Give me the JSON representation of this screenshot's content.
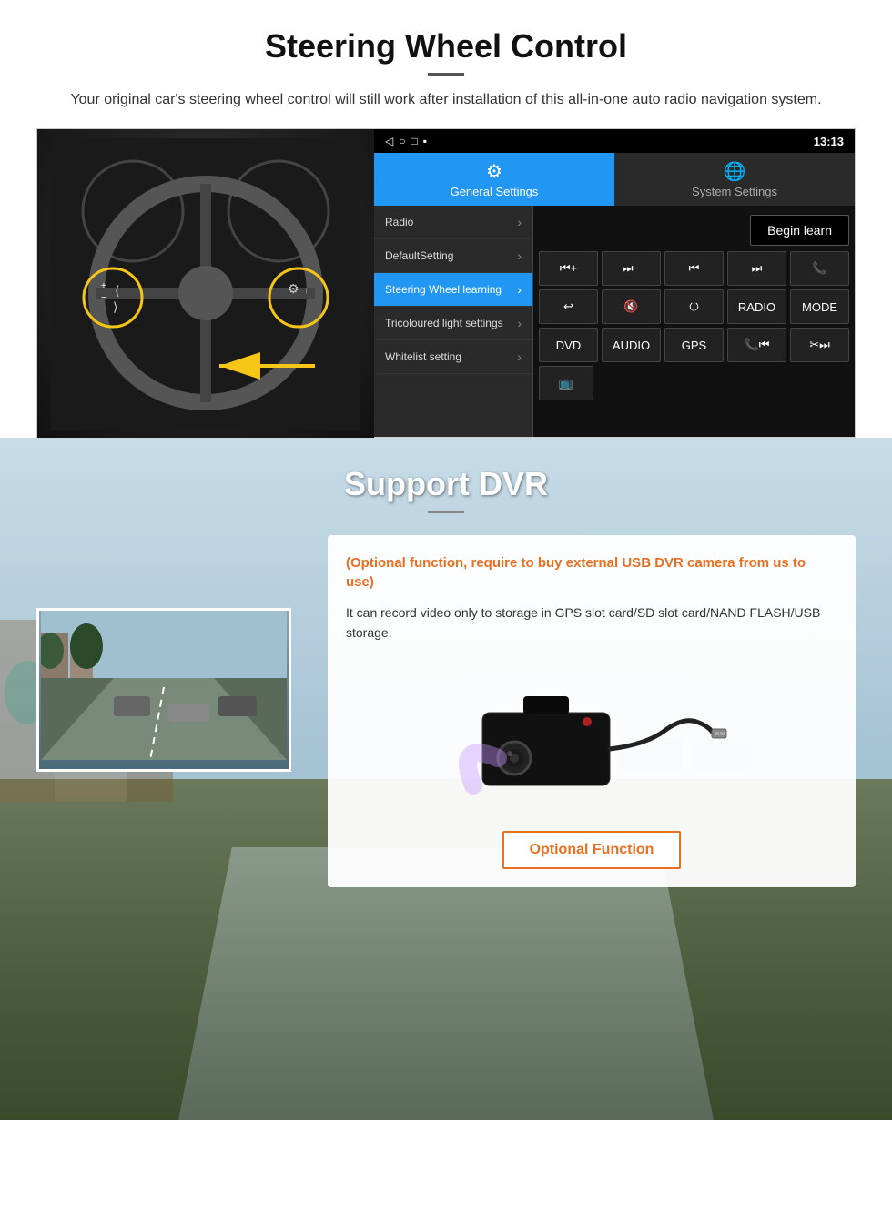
{
  "section1": {
    "title": "Steering Wheel Control",
    "subtitle": "Your original car's steering wheel control will still work after installation of this all-in-one auto radio navigation system.",
    "android_ui": {
      "statusbar": {
        "time": "13:13",
        "nav_icons": [
          "◁",
          "○",
          "□",
          "▪"
        ]
      },
      "tabs": [
        {
          "label": "General Settings",
          "icon": "⚙",
          "active": true
        },
        {
          "label": "System Settings",
          "icon": "🌐",
          "active": false
        }
      ],
      "menu_items": [
        {
          "label": "Radio",
          "active": false
        },
        {
          "label": "DefaultSetting",
          "active": false
        },
        {
          "label": "Steering Wheel learning",
          "active": true
        },
        {
          "label": "Tricoloured light settings",
          "active": false
        },
        {
          "label": "Whitelist setting",
          "active": false
        }
      ],
      "begin_learn_label": "Begin learn",
      "controls": [
        [
          "⏮+",
          "⏭−",
          "⏮⏮",
          "⏭⏭",
          "📞"
        ],
        [
          "↩",
          "🔇",
          "⏻",
          "RADIO",
          "MODE"
        ],
        [
          "DVD",
          "AUDIO",
          "GPS",
          "📞⏮",
          "✂️⏭"
        ],
        [
          "📺"
        ]
      ]
    }
  },
  "section2": {
    "title": "Support DVR",
    "optional_text": "(Optional function, require to buy external USB DVR camera from us to use)",
    "description": "It can record video only to storage in GPS slot card/SD slot card/NAND FLASH/USB storage.",
    "optional_button_label": "Optional Function"
  }
}
